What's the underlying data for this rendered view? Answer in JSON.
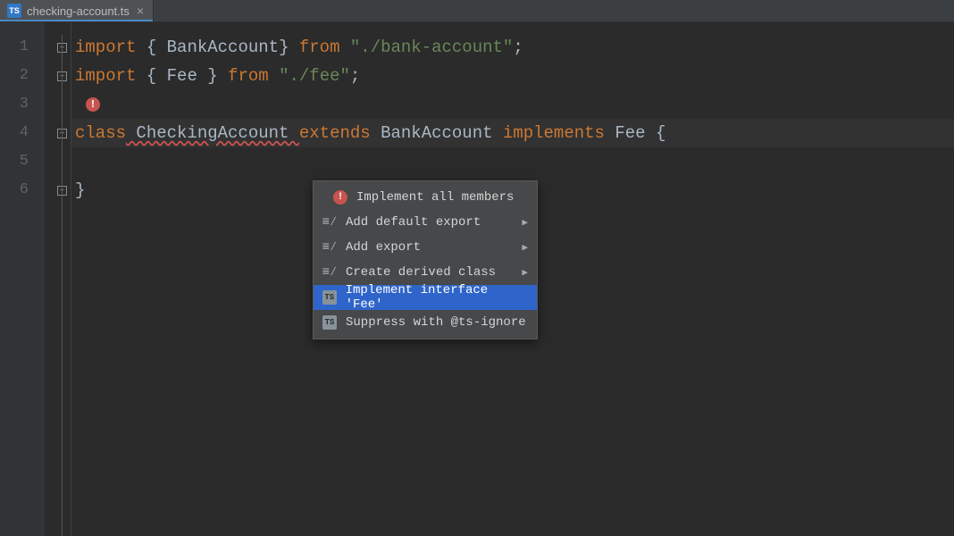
{
  "tab": {
    "filename": "checking-account.ts",
    "language_badge": "TS"
  },
  "gutter": {
    "line_numbers": [
      "1",
      "2",
      "3",
      "4",
      "5",
      "6"
    ]
  },
  "code": {
    "line1": {
      "kw_import": "import",
      "brace_open": " { ",
      "ident": "BankAccount",
      "brace_close": "} ",
      "kw_from": "from",
      "str": "\"./bank-account\"",
      "semi": ";"
    },
    "line2": {
      "kw_import": "import",
      "brace_open": " { ",
      "ident": "Fee",
      "brace_close": " } ",
      "kw_from": "from",
      "str": "\"./fee\"",
      "semi": ";"
    },
    "line4": {
      "kw_class": "class",
      "classname": " CheckingAccount ",
      "kw_extends": "extends",
      "base": " BankAccount ",
      "kw_implements": "implements",
      "iface": " Fee ",
      "brace": "{"
    },
    "line6": {
      "brace_close": "}"
    }
  },
  "menu": {
    "items": [
      {
        "icon": "bulb",
        "label": "Implement all members",
        "submenu": false,
        "selected": false
      },
      {
        "icon": "lines",
        "label": "Add default export",
        "submenu": true,
        "selected": false
      },
      {
        "icon": "lines",
        "label": "Add export",
        "submenu": true,
        "selected": false
      },
      {
        "icon": "lines",
        "label": "Create derived class",
        "submenu": true,
        "selected": false
      },
      {
        "icon": "ts",
        "label": "Implement interface 'Fee'",
        "submenu": false,
        "selected": true
      },
      {
        "icon": "ts",
        "label": "Suppress with @ts-ignore",
        "submenu": false,
        "selected": false
      }
    ]
  }
}
